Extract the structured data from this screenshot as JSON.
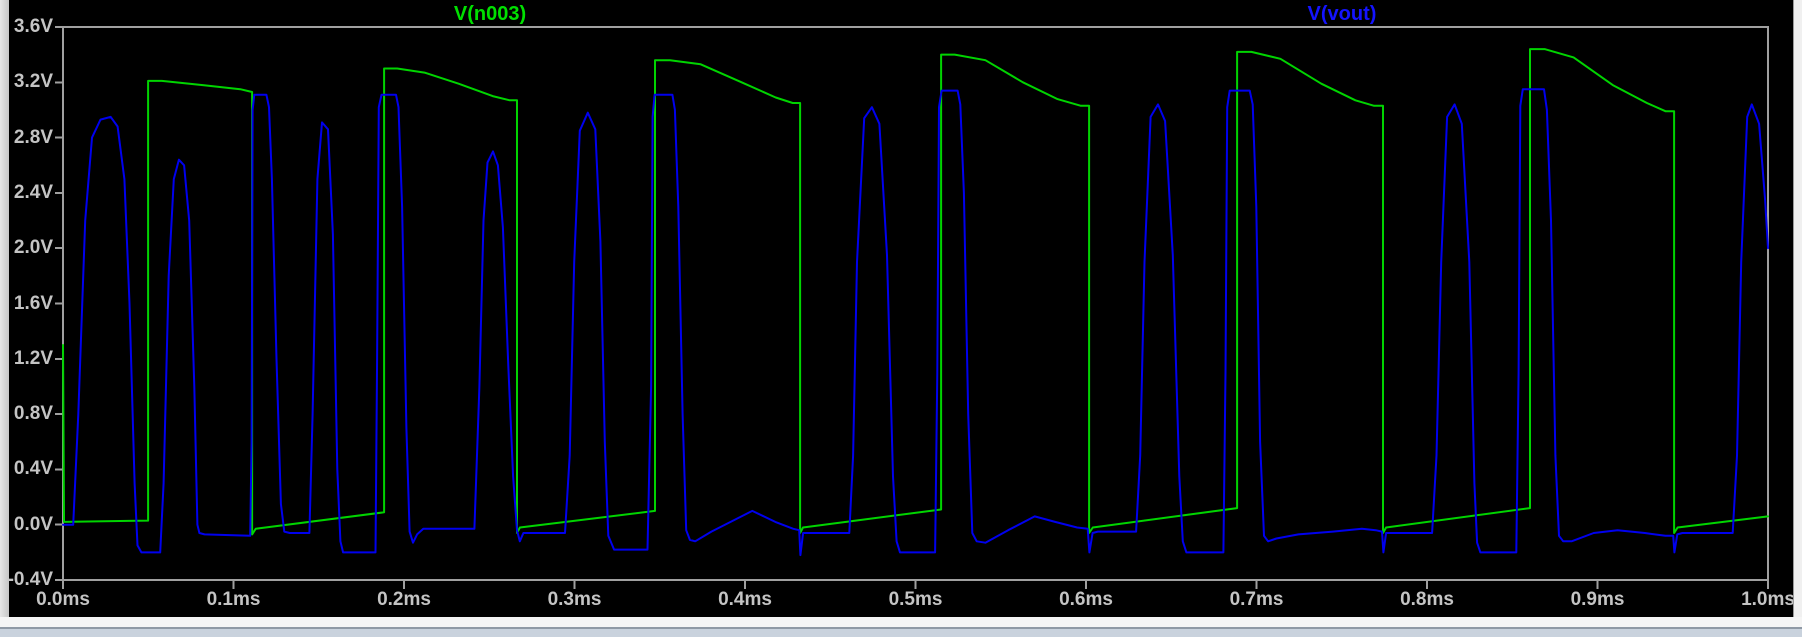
{
  "legend": {
    "n003_label": "V(n003)",
    "vout_label": "V(vout)"
  },
  "colors": {
    "background": "#000000",
    "frame": "#a0a0a0",
    "axis_text": "#c4c4c4",
    "trace_n003": "#00d400",
    "trace_vout": "#0000ee",
    "label_n003": "#00e000",
    "label_vout": "#1414ff"
  },
  "chart_data": {
    "type": "line",
    "title": "",
    "grid": false,
    "legend_position": "top",
    "xlim": [
      0.0,
      1.0
    ],
    "ylim": [
      -0.4,
      3.6
    ],
    "x_ticks": [
      {
        "t": 0.0,
        "label": "0.0ms"
      },
      {
        "t": 0.1,
        "label": "0.1ms"
      },
      {
        "t": 0.2,
        "label": "0.2ms"
      },
      {
        "t": 0.3,
        "label": "0.3ms"
      },
      {
        "t": 0.4,
        "label": "0.4ms"
      },
      {
        "t": 0.5,
        "label": "0.5ms"
      },
      {
        "t": 0.6,
        "label": "0.6ms"
      },
      {
        "t": 0.7,
        "label": "0.7ms"
      },
      {
        "t": 0.8,
        "label": "0.8ms"
      },
      {
        "t": 0.9,
        "label": "0.9ms"
      },
      {
        "t": 1.0,
        "label": "1.0ms"
      }
    ],
    "y_ticks": [
      {
        "v": 3.6,
        "label": "3.6V"
      },
      {
        "v": 3.2,
        "label": "3.2V"
      },
      {
        "v": 2.8,
        "label": "2.8V"
      },
      {
        "v": 2.4,
        "label": "2.4V"
      },
      {
        "v": 2.0,
        "label": "2.0V"
      },
      {
        "v": 1.6,
        "label": "1.6V"
      },
      {
        "v": 1.2,
        "label": "1.2V"
      },
      {
        "v": 0.8,
        "label": "0.8V"
      },
      {
        "v": 0.4,
        "label": "0.4V"
      },
      {
        "v": 0.0,
        "label": "0.0V"
      },
      {
        "v": -0.4,
        "label": "-0.4V"
      }
    ],
    "series": [
      {
        "name": "V(n003)",
        "color": "#00d400",
        "points": [
          [
            0.0,
            1.3
          ],
          [
            0.0006,
            0.02
          ],
          [
            0.0499,
            0.03
          ],
          [
            0.0499,
            3.21
          ],
          [
            0.058,
            3.21
          ],
          [
            0.082,
            3.18
          ],
          [
            0.104,
            3.15
          ],
          [
            0.1109,
            3.13
          ],
          [
            0.1109,
            -0.07
          ],
          [
            0.113,
            -0.03
          ],
          [
            0.1883,
            0.09
          ],
          [
            0.1883,
            3.3
          ],
          [
            0.196,
            3.3
          ],
          [
            0.212,
            3.27
          ],
          [
            0.232,
            3.19
          ],
          [
            0.252,
            3.1
          ],
          [
            0.262,
            3.07
          ],
          [
            0.2663,
            3.07
          ],
          [
            0.2663,
            -0.06
          ],
          [
            0.268,
            -0.02
          ],
          [
            0.3472,
            0.1
          ],
          [
            0.3472,
            3.36
          ],
          [
            0.356,
            3.36
          ],
          [
            0.374,
            3.33
          ],
          [
            0.398,
            3.2
          ],
          [
            0.418,
            3.09
          ],
          [
            0.428,
            3.05
          ],
          [
            0.4323,
            3.05
          ],
          [
            0.4323,
            -0.06
          ],
          [
            0.434,
            -0.02
          ],
          [
            0.515,
            0.11
          ],
          [
            0.515,
            3.4
          ],
          [
            0.523,
            3.4
          ],
          [
            0.541,
            3.36
          ],
          [
            0.563,
            3.2
          ],
          [
            0.583,
            3.08
          ],
          [
            0.597,
            3.03
          ],
          [
            0.6018,
            3.03
          ],
          [
            0.6018,
            -0.06
          ],
          [
            0.604,
            -0.02
          ],
          [
            0.6886,
            0.12
          ],
          [
            0.6886,
            3.42
          ],
          [
            0.697,
            3.42
          ],
          [
            0.714,
            3.37
          ],
          [
            0.738,
            3.19
          ],
          [
            0.758,
            3.07
          ],
          [
            0.769,
            3.03
          ],
          [
            0.7742,
            3.03
          ],
          [
            0.7742,
            -0.06
          ],
          [
            0.776,
            -0.02
          ],
          [
            0.8604,
            0.12
          ],
          [
            0.8604,
            3.44
          ],
          [
            0.869,
            3.44
          ],
          [
            0.886,
            3.38
          ],
          [
            0.909,
            3.18
          ],
          [
            0.929,
            3.05
          ],
          [
            0.94,
            2.99
          ],
          [
            0.9449,
            2.99
          ],
          [
            0.9449,
            -0.06
          ],
          [
            0.947,
            -0.02
          ],
          [
            1.0,
            0.06
          ]
        ]
      },
      {
        "name": "V(vout)",
        "color": "#0000ee",
        "points": [
          [
            0.0,
            0.0
          ],
          [
            0.006,
            0.0
          ],
          [
            0.009,
            0.8
          ],
          [
            0.013,
            2.2
          ],
          [
            0.017,
            2.8
          ],
          [
            0.022,
            2.93
          ],
          [
            0.028,
            2.95
          ],
          [
            0.032,
            2.88
          ],
          [
            0.036,
            2.5
          ],
          [
            0.039,
            1.6
          ],
          [
            0.042,
            0.3
          ],
          [
            0.0437,
            -0.15
          ],
          [
            0.046,
            -0.2
          ],
          [
            0.057,
            -0.2
          ],
          [
            0.059,
            0.3
          ],
          [
            0.062,
            1.8
          ],
          [
            0.065,
            2.5
          ],
          [
            0.068,
            2.64
          ],
          [
            0.071,
            2.6
          ],
          [
            0.074,
            2.2
          ],
          [
            0.077,
            1.0
          ],
          [
            0.0788,
            0.0
          ],
          [
            0.08,
            -0.06
          ],
          [
            0.083,
            -0.07
          ],
          [
            0.1098,
            -0.08
          ],
          [
            0.1106,
            0.6
          ],
          [
            0.1112,
            3.0
          ],
          [
            0.1122,
            3.11
          ],
          [
            0.1193,
            3.11
          ],
          [
            0.1208,
            3.02
          ],
          [
            0.1225,
            2.5
          ],
          [
            0.1252,
            1.2
          ],
          [
            0.1278,
            0.15
          ],
          [
            0.1298,
            -0.05
          ],
          [
            0.133,
            -0.06
          ],
          [
            0.1445,
            -0.06
          ],
          [
            0.1464,
            0.8
          ],
          [
            0.1492,
            2.5
          ],
          [
            0.1519,
            2.91
          ],
          [
            0.1554,
            2.86
          ],
          [
            0.1583,
            2.1
          ],
          [
            0.1609,
            0.4
          ],
          [
            0.1627,
            -0.12
          ],
          [
            0.1643,
            -0.2
          ],
          [
            0.1833,
            -0.2
          ],
          [
            0.1842,
            1.2
          ],
          [
            0.1852,
            3.02
          ],
          [
            0.1868,
            3.11
          ],
          [
            0.1953,
            3.11
          ],
          [
            0.1968,
            3.02
          ],
          [
            0.1989,
            2.3
          ],
          [
            0.2014,
            0.7
          ],
          [
            0.2033,
            -0.05
          ],
          [
            0.2053,
            -0.13
          ],
          [
            0.2077,
            -0.07
          ],
          [
            0.2113,
            -0.03
          ],
          [
            0.2413,
            -0.03
          ],
          [
            0.2442,
            1.0
          ],
          [
            0.2466,
            2.2
          ],
          [
            0.249,
            2.62
          ],
          [
            0.2522,
            2.7
          ],
          [
            0.2551,
            2.6
          ],
          [
            0.258,
            2.15
          ],
          [
            0.2612,
            1.15
          ],
          [
            0.264,
            0.35
          ],
          [
            0.2663,
            -0.04
          ],
          [
            0.2679,
            -0.12
          ],
          [
            0.27,
            -0.06
          ],
          [
            0.2944,
            -0.06
          ],
          [
            0.2972,
            0.5
          ],
          [
            0.2998,
            1.9
          ],
          [
            0.3031,
            2.85
          ],
          [
            0.3078,
            2.98
          ],
          [
            0.3122,
            2.86
          ],
          [
            0.3152,
            2.05
          ],
          [
            0.3178,
            0.6
          ],
          [
            0.3198,
            -0.08
          ],
          [
            0.3232,
            -0.18
          ],
          [
            0.3428,
            -0.18
          ],
          [
            0.3449,
            1.0
          ],
          [
            0.3458,
            2.95
          ],
          [
            0.347,
            3.11
          ],
          [
            0.3574,
            3.11
          ],
          [
            0.3589,
            3.0
          ],
          [
            0.3609,
            2.3
          ],
          [
            0.3634,
            0.8
          ],
          [
            0.3655,
            -0.04
          ],
          [
            0.3677,
            -0.11
          ],
          [
            0.3708,
            -0.12
          ],
          [
            0.3803,
            -0.05
          ],
          [
            0.4043,
            0.1
          ],
          [
            0.4178,
            0.02
          ],
          [
            0.4283,
            -0.03
          ],
          [
            0.4318,
            -0.04
          ],
          [
            0.4325,
            -0.22
          ],
          [
            0.4341,
            -0.06
          ],
          [
            0.4369,
            -0.06
          ],
          [
            0.4612,
            -0.06
          ],
          [
            0.4634,
            0.5
          ],
          [
            0.4657,
            1.9
          ],
          [
            0.4699,
            2.94
          ],
          [
            0.4744,
            3.02
          ],
          [
            0.4788,
            2.9
          ],
          [
            0.4833,
            1.95
          ],
          [
            0.4868,
            0.35
          ],
          [
            0.4889,
            -0.12
          ],
          [
            0.4909,
            -0.2
          ],
          [
            0.5115,
            -0.2
          ],
          [
            0.5128,
            1.1
          ],
          [
            0.5138,
            3.02
          ],
          [
            0.5153,
            3.14
          ],
          [
            0.5247,
            3.14
          ],
          [
            0.5263,
            3.04
          ],
          [
            0.5284,
            2.4
          ],
          [
            0.5309,
            0.8
          ],
          [
            0.5333,
            -0.06
          ],
          [
            0.5359,
            -0.12
          ],
          [
            0.541,
            -0.13
          ],
          [
            0.5543,
            -0.04
          ],
          [
            0.5699,
            0.06
          ],
          [
            0.5819,
            0.02
          ],
          [
            0.5948,
            -0.02
          ],
          [
            0.601,
            -0.03
          ],
          [
            0.602,
            -0.2
          ],
          [
            0.6039,
            -0.06
          ],
          [
            0.6069,
            -0.05
          ],
          [
            0.6294,
            -0.05
          ],
          [
            0.6318,
            0.5
          ],
          [
            0.6343,
            1.9
          ],
          [
            0.6379,
            2.95
          ],
          [
            0.6422,
            3.04
          ],
          [
            0.6464,
            2.92
          ],
          [
            0.6509,
            1.95
          ],
          [
            0.6547,
            0.35
          ],
          [
            0.6568,
            -0.12
          ],
          [
            0.6589,
            -0.2
          ],
          [
            0.6806,
            -0.2
          ],
          [
            0.6818,
            1.1
          ],
          [
            0.6828,
            3.02
          ],
          [
            0.6843,
            3.14
          ],
          [
            0.696,
            3.14
          ],
          [
            0.6978,
            3.04
          ],
          [
            0.6999,
            2.3
          ],
          [
            0.7021,
            0.6
          ],
          [
            0.7044,
            -0.08
          ],
          [
            0.7068,
            -0.12
          ],
          [
            0.7117,
            -0.1
          ],
          [
            0.7246,
            -0.07
          ],
          [
            0.7448,
            -0.05
          ],
          [
            0.7618,
            -0.03
          ],
          [
            0.7699,
            -0.04
          ],
          [
            0.7736,
            -0.05
          ],
          [
            0.7744,
            -0.2
          ],
          [
            0.776,
            -0.06
          ],
          [
            0.7789,
            -0.06
          ],
          [
            0.803,
            -0.06
          ],
          [
            0.8056,
            0.5
          ],
          [
            0.8083,
            1.9
          ],
          [
            0.8118,
            2.95
          ],
          [
            0.8162,
            3.04
          ],
          [
            0.8204,
            2.9
          ],
          [
            0.8248,
            1.9
          ],
          [
            0.8278,
            0.3
          ],
          [
            0.8294,
            -0.13
          ],
          [
            0.8313,
            -0.2
          ],
          [
            0.8524,
            -0.2
          ],
          [
            0.8537,
            1.1
          ],
          [
            0.8547,
            3.03
          ],
          [
            0.8562,
            3.15
          ],
          [
            0.8686,
            3.15
          ],
          [
            0.8703,
            3.0
          ],
          [
            0.8727,
            2.2
          ],
          [
            0.8753,
            0.5
          ],
          [
            0.8774,
            -0.08
          ],
          [
            0.8799,
            -0.12
          ],
          [
            0.8848,
            -0.12
          ],
          [
            0.8978,
            -0.06
          ],
          [
            0.9118,
            -0.04
          ],
          [
            0.9278,
            -0.06
          ],
          [
            0.9398,
            -0.08
          ],
          [
            0.9444,
            -0.08
          ],
          [
            0.9451,
            -0.2
          ],
          [
            0.9468,
            -0.07
          ],
          [
            0.9498,
            -0.06
          ],
          [
            0.9793,
            -0.06
          ],
          [
            0.9818,
            0.5
          ],
          [
            0.9843,
            1.9
          ],
          [
            0.9878,
            2.95
          ],
          [
            0.9905,
            3.04
          ],
          [
            0.9948,
            2.9
          ],
          [
            0.9983,
            2.35
          ],
          [
            1.0,
            2.0
          ]
        ]
      }
    ]
  }
}
